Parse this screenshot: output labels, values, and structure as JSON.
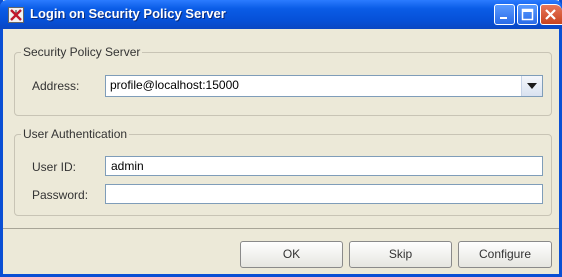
{
  "window": {
    "title": "Login on Security Policy Server"
  },
  "server_group": {
    "legend": "Security Policy Server",
    "address_label": "Address:",
    "address_value": "profile@localhost:15000"
  },
  "auth_group": {
    "legend": "User Authentication",
    "userid_label": "User ID:",
    "userid_value": "admin",
    "password_label": "Password:",
    "password_value": ""
  },
  "buttons": {
    "ok": "OK",
    "skip": "Skip",
    "configure": "Configure"
  },
  "colors": {
    "titlebar": "#0a5ce6",
    "window_bg": "#ece9d8",
    "close_button": "#c8431f",
    "field_border": "#7f9db9"
  },
  "icons": {
    "app": "app-icon",
    "minimize": "minimize-icon",
    "maximize": "maximize-icon",
    "close": "close-icon",
    "dropdown": "chevron-down-icon"
  }
}
